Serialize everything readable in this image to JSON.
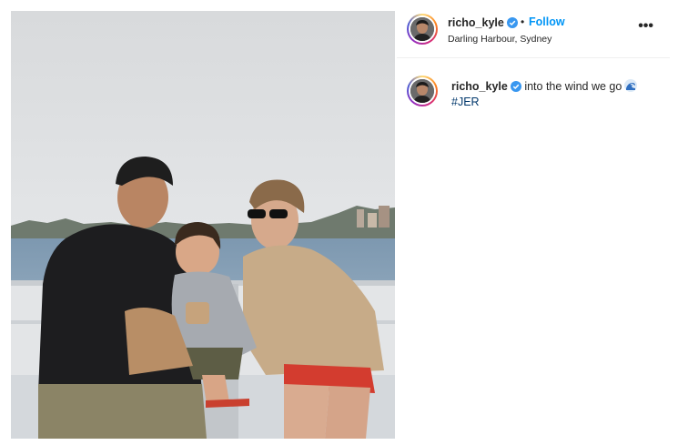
{
  "post": {
    "author": {
      "username": "richo_kyle",
      "verified": true,
      "location": "Darling Harbour, Sydney"
    },
    "header": {
      "dot": "•",
      "follow_label": "Follow",
      "more_icon": "more-horizontal-icon",
      "more_glyph": "•••"
    },
    "caption": {
      "username": "richo_kyle",
      "text": "into the wind we go",
      "emoji": "water-wave-icon",
      "hashtag": "#JER"
    }
  },
  "colors": {
    "follow_blue": "#0095f6",
    "verified_blue": "#3897f0",
    "hashtag_blue": "#00376b",
    "text": "#262626"
  }
}
